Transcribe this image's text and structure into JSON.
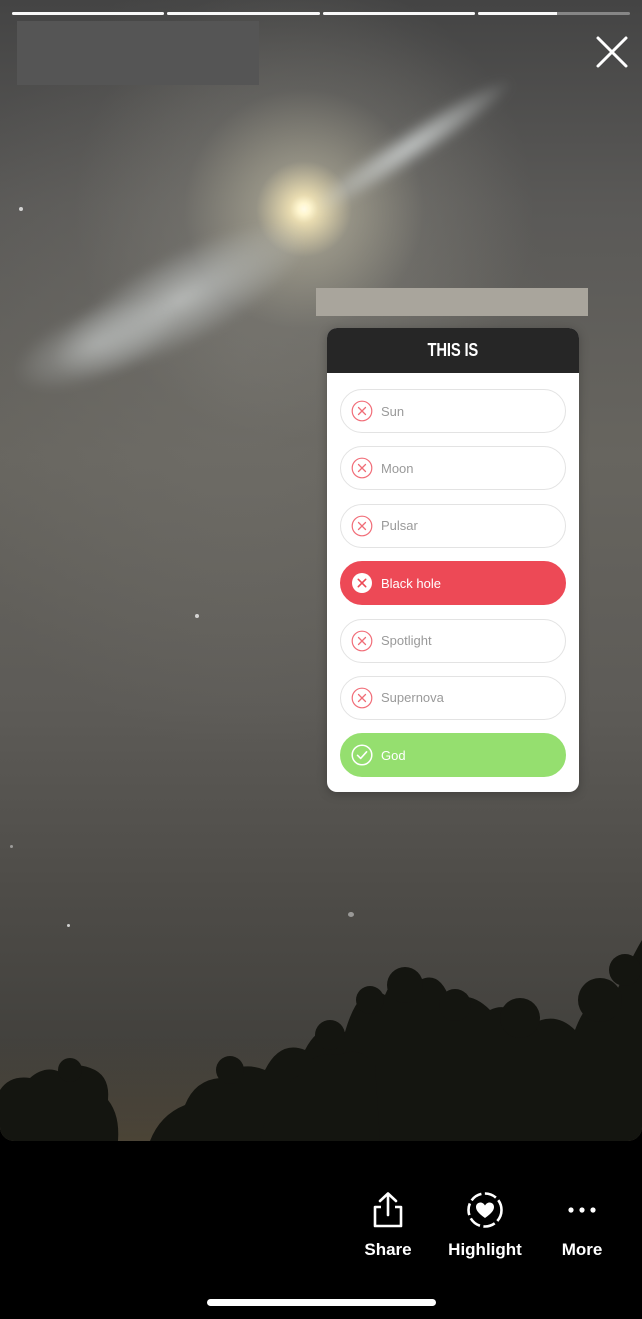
{
  "progress": {
    "segments": [
      1,
      1,
      1,
      0.52
    ]
  },
  "close": {
    "icon": "close-icon"
  },
  "quiz": {
    "title": "THIS IS",
    "options": [
      {
        "label": "Sun",
        "state": "wrong",
        "icon": "x-circle-icon"
      },
      {
        "label": "Moon",
        "state": "wrong",
        "icon": "x-circle-icon"
      },
      {
        "label": "Pulsar",
        "state": "wrong",
        "icon": "x-circle-icon"
      },
      {
        "label": "Black hole",
        "state": "selected-wrong",
        "icon": "x-circle-icon"
      },
      {
        "label": "Spotlight",
        "state": "wrong",
        "icon": "x-circle-icon"
      },
      {
        "label": "Supernova",
        "state": "wrong",
        "icon": "x-circle-icon"
      },
      {
        "label": "God",
        "state": "correct",
        "icon": "check-circle-icon"
      }
    ],
    "colors": {
      "header": "#262626",
      "wrong_selected": "#ed4956",
      "correct": "#95df6f",
      "wrong_icon": "#ed4956"
    }
  },
  "bottom_bar": {
    "share": {
      "label": "Share",
      "icon": "share-icon"
    },
    "highlight": {
      "label": "Highlight",
      "icon": "highlight-heart-icon"
    },
    "more": {
      "label": "More",
      "icon": "more-dots-icon"
    }
  }
}
